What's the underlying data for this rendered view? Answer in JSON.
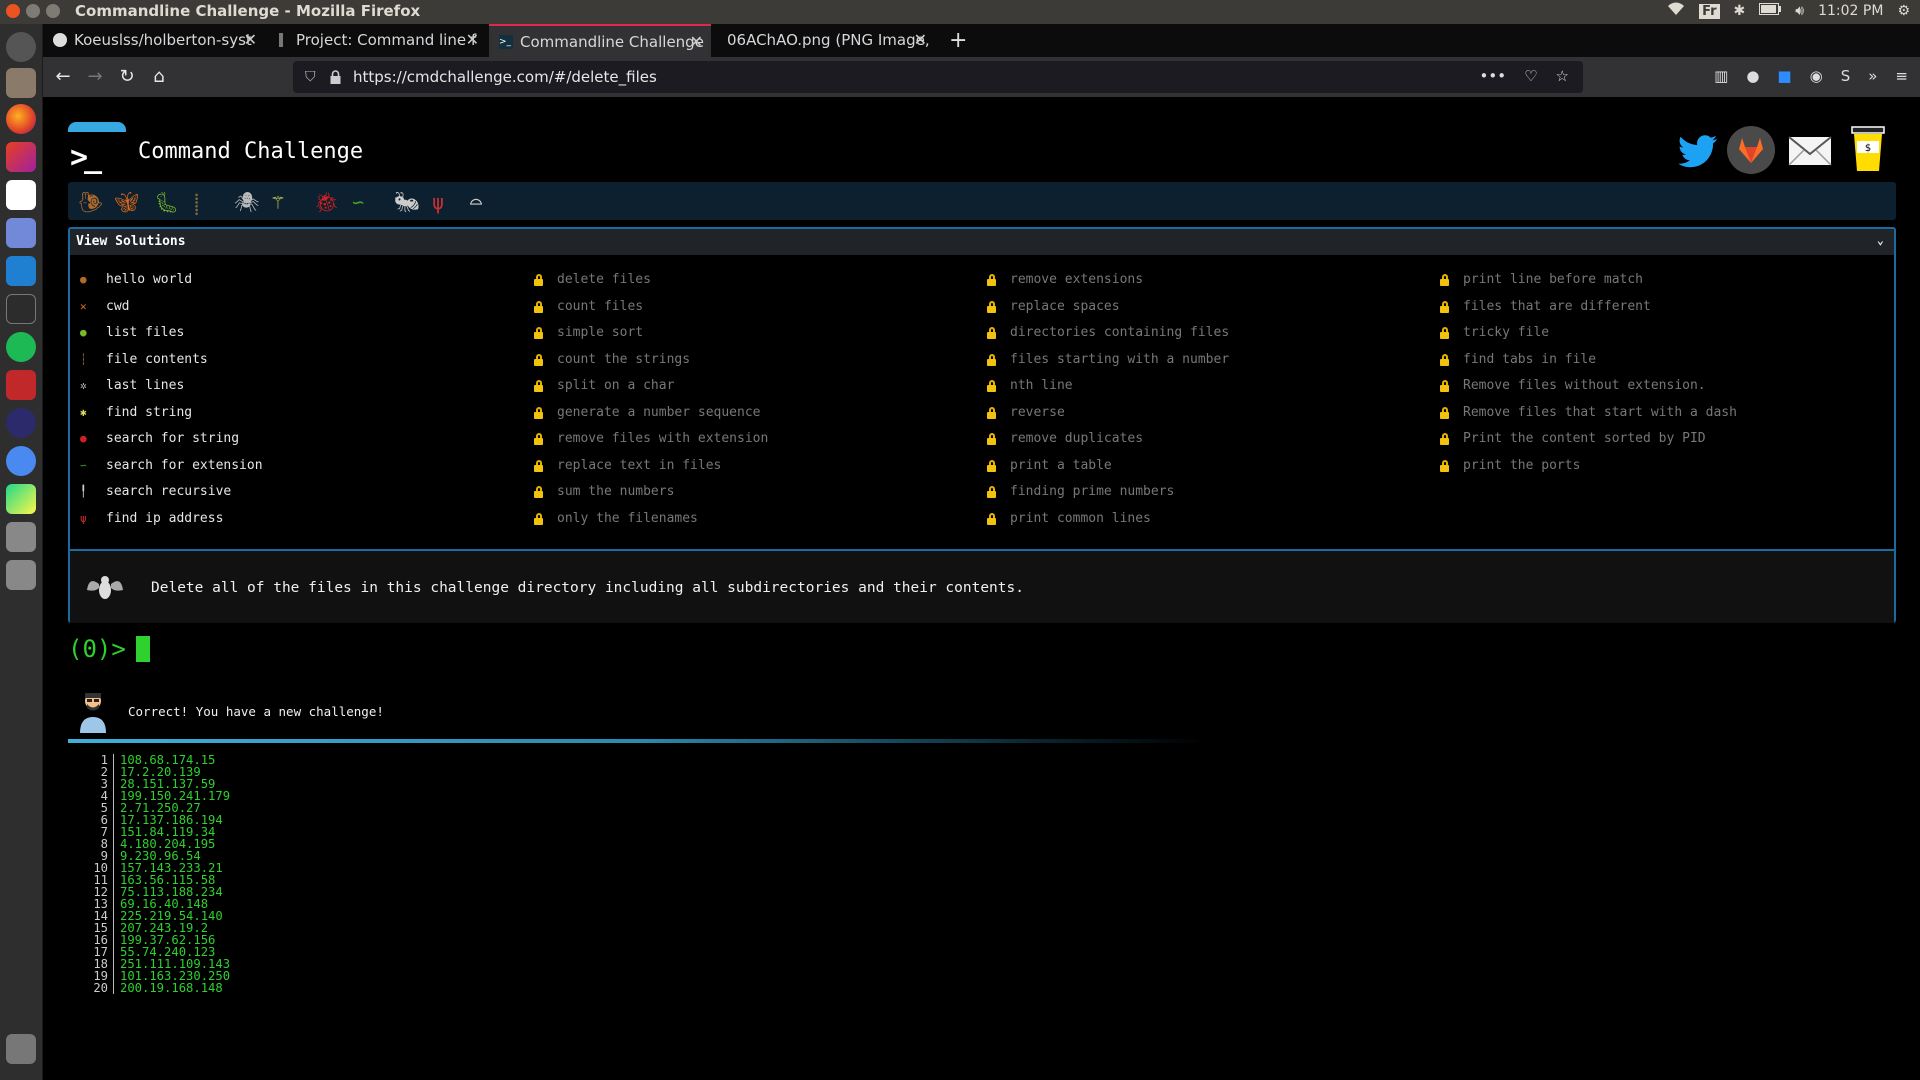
{
  "os": {
    "window_title": "Commandline Challenge - Mozilla Firefox",
    "tray": {
      "lang": "Fr",
      "clock": "11:02 PM"
    }
  },
  "browser": {
    "tabs": [
      {
        "label": "Koeuslss/holberton-syst",
        "icon": "github-icon"
      },
      {
        "label": "Project: Command line f",
        "icon": "project-icon"
      },
      {
        "label": "Commandline Challenge",
        "icon": "terminal-icon",
        "active": true
      },
      {
        "label": "06AChAO.png (PNG Image,",
        "icon": "image-icon"
      }
    ],
    "url": "https://cmdchallenge.com/#/delete_files"
  },
  "page": {
    "title": "Command Challenge",
    "logo_prompt": ">_",
    "social": [
      "twitter-icon",
      "gitlab-icon",
      "email-icon",
      "coffee-cup-icon"
    ],
    "solutions_header": "View Solutions",
    "columns": [
      [
        {
          "label": "hello world",
          "icon": "snail-icon",
          "color": "#b06a2a"
        },
        {
          "label": "cwd",
          "icon": "butterfly-icon",
          "color": "#e06a1a"
        },
        {
          "label": "list files",
          "icon": "caterpillar-icon",
          "color": "#7ab82a"
        },
        {
          "label": "file contents",
          "icon": "stick-bug-icon",
          "color": "#8a6a3a"
        },
        {
          "label": "last lines",
          "icon": "spider-icon",
          "color": "#bbbbbb"
        },
        {
          "label": "find string",
          "icon": "dragonfly-icon",
          "color": "#d8e060"
        },
        {
          "label": "search for string",
          "icon": "ladybug-icon",
          "color": "#d02020"
        },
        {
          "label": "search for extension",
          "icon": "worm-icon",
          "color": "#4aa02a"
        },
        {
          "label": "search recursive",
          "icon": "ant-icon",
          "color": "#cccccc"
        },
        {
          "label": "find ip address",
          "icon": "mantis-icon",
          "color": "#c83030"
        }
      ],
      [
        {
          "label": "delete files"
        },
        {
          "label": "count files"
        },
        {
          "label": "simple sort"
        },
        {
          "label": "count the strings"
        },
        {
          "label": "split on a char"
        },
        {
          "label": "generate a number sequence"
        },
        {
          "label": "remove files with extension"
        },
        {
          "label": "replace text in files"
        },
        {
          "label": "sum the numbers"
        },
        {
          "label": "only the filenames"
        }
      ],
      [
        {
          "label": "remove extensions"
        },
        {
          "label": "replace spaces"
        },
        {
          "label": "directories containing files"
        },
        {
          "label": "files starting with a number"
        },
        {
          "label": "nth line"
        },
        {
          "label": "reverse"
        },
        {
          "label": "remove duplicates"
        },
        {
          "label": "print a table"
        },
        {
          "label": "finding prime numbers"
        },
        {
          "label": "print common lines"
        }
      ],
      [
        {
          "label": "print line before match"
        },
        {
          "label": "files that are different"
        },
        {
          "label": "tricky file"
        },
        {
          "label": "find tabs in file"
        },
        {
          "label": "Remove files without extension."
        },
        {
          "label": "Remove files that start with a dash"
        },
        {
          "label": "Print the content sorted by PID"
        },
        {
          "label": "print the ports"
        }
      ]
    ],
    "challenge_description": "Delete all of the files in this challenge directory including all subdirectories and their contents.",
    "prompt": "(0)>",
    "correct_message": "Correct! You have a new challenge!",
    "output_lines": [
      "108.68.174.15",
      "17.2.20.139",
      "28.151.137.59",
      "199.150.241.179",
      "2.71.250.27",
      "17.137.186.194",
      "151.84.119.34",
      "4.180.204.195",
      "9.230.96.54",
      "157.143.233.21",
      "163.56.115.58",
      "75.113.188.234",
      "69.16.40.148",
      "225.219.54.140",
      "207.243.19.2",
      "199.37.62.156",
      "55.74.240.123",
      "251.111.109.143",
      "101.163.230.250",
      "200.19.168.148"
    ]
  }
}
